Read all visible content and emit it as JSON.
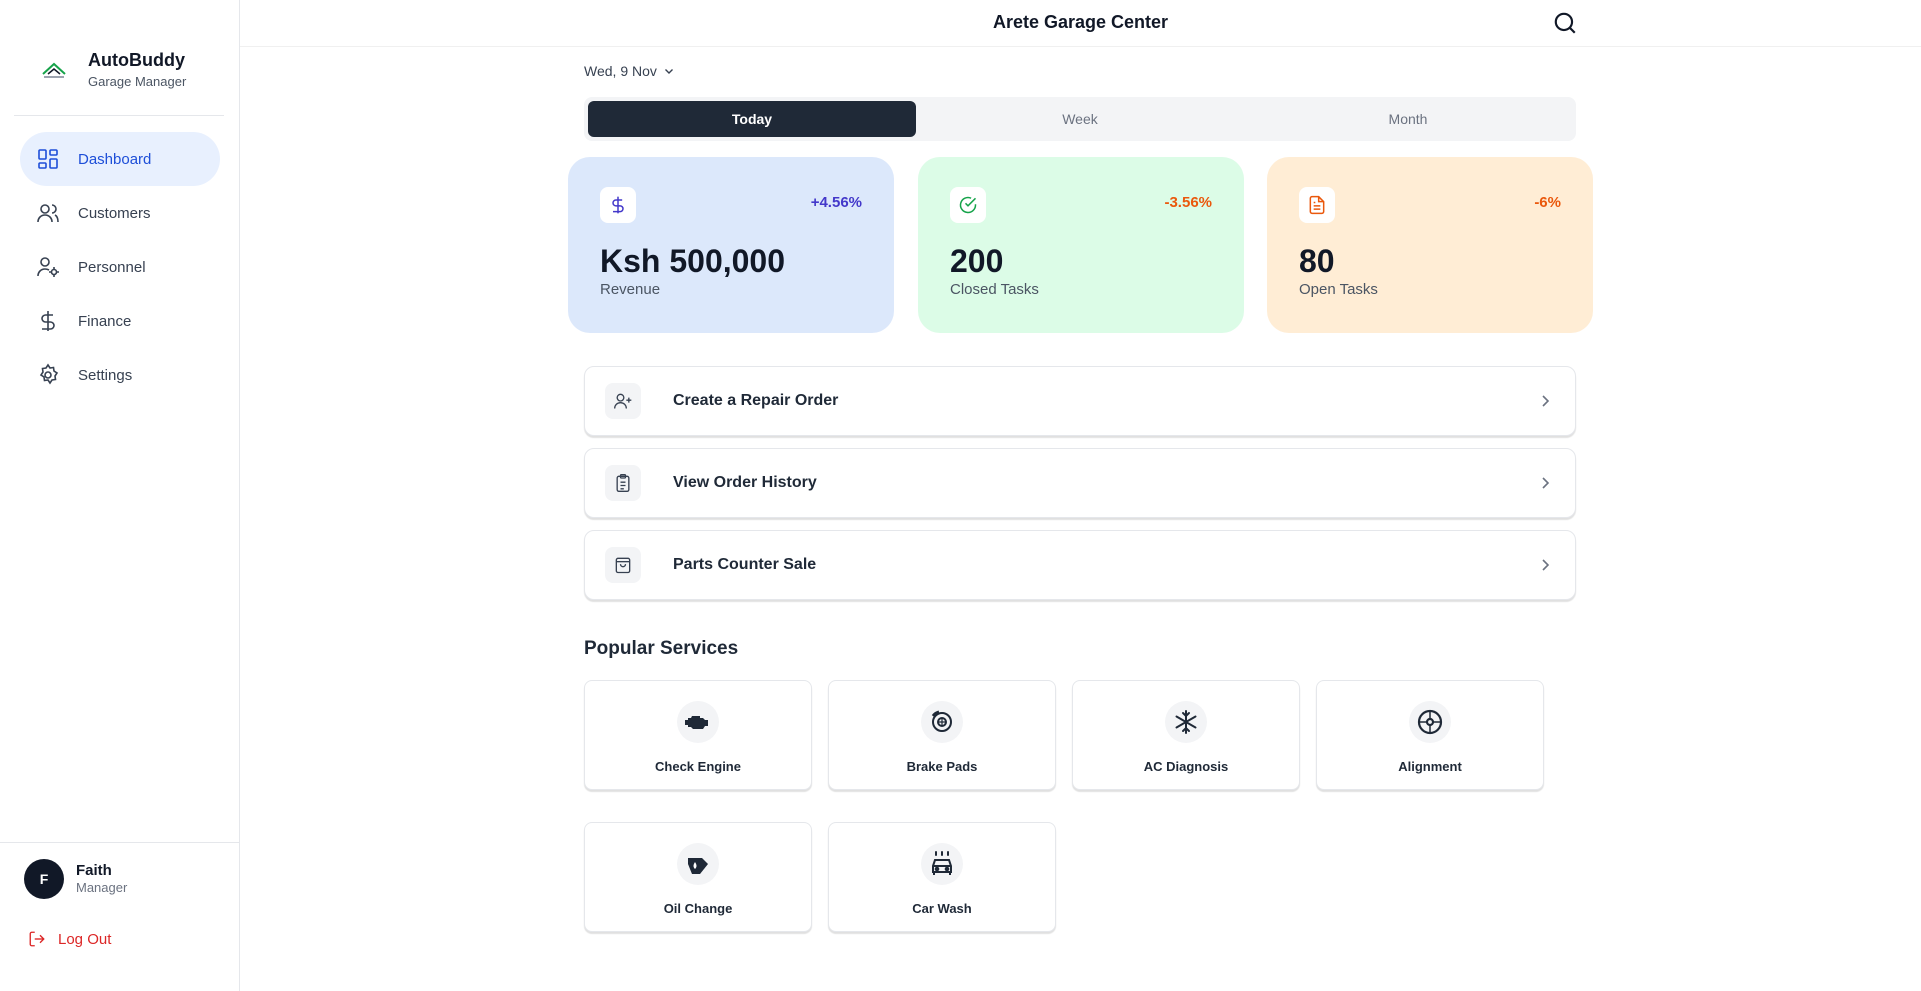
{
  "sidebar": {
    "brand_name": "AutoBuddy",
    "brand_subtitle": "Garage Manager",
    "items": [
      {
        "label": "Dashboard",
        "icon": "dashboard-icon",
        "active": true
      },
      {
        "label": "Customers",
        "icon": "users-icon"
      },
      {
        "label": "Personnel",
        "icon": "user-gear-icon"
      },
      {
        "label": "Finance",
        "icon": "dollar-icon"
      },
      {
        "label": "Settings",
        "icon": "gear-icon"
      }
    ],
    "user": {
      "initial": "F",
      "name": "Faith",
      "role": "Manager"
    },
    "logout_label": "Log Out"
  },
  "header": {
    "title": "Arete Garage Center",
    "search_icon": "search-icon"
  },
  "date_selector": "Wed, 9 Nov",
  "tabs": [
    {
      "label": "Today",
      "active": true
    },
    {
      "label": "Week"
    },
    {
      "label": "Month"
    }
  ],
  "stats": [
    {
      "icon": "dollar-icon",
      "change": "+4.56%",
      "value": "Ksh 500,000",
      "label": "Revenue",
      "color": "#dce8fb",
      "accent": "#4338ca"
    },
    {
      "icon": "check-circle-icon",
      "change": "-3.56%",
      "value": "200",
      "label": "Closed Tasks",
      "color": "#dcfce7",
      "accent": "#ea580c"
    },
    {
      "icon": "document-icon",
      "change": "-6%",
      "value": "80",
      "label": "Open Tasks",
      "color": "#ffedd5",
      "accent": "#ea580c"
    }
  ],
  "actions": [
    {
      "label": "Create a Repair Order",
      "icon": "user-plus-icon"
    },
    {
      "label": "View Order History",
      "icon": "clipboard-icon"
    },
    {
      "label": "Parts Counter Sale",
      "icon": "shopping-bag-icon"
    }
  ],
  "popular_services": {
    "title": "Popular Services",
    "items": [
      {
        "label": "Check Engine",
        "icon": "engine-icon"
      },
      {
        "label": "Brake Pads",
        "icon": "brake-icon"
      },
      {
        "label": "AC Diagnosis",
        "icon": "snowflake-icon"
      },
      {
        "label": "Alignment",
        "icon": "wheel-icon"
      },
      {
        "label": "Oil Change",
        "icon": "oil-can-icon"
      },
      {
        "label": "Car Wash",
        "icon": "car-wash-icon"
      }
    ]
  }
}
